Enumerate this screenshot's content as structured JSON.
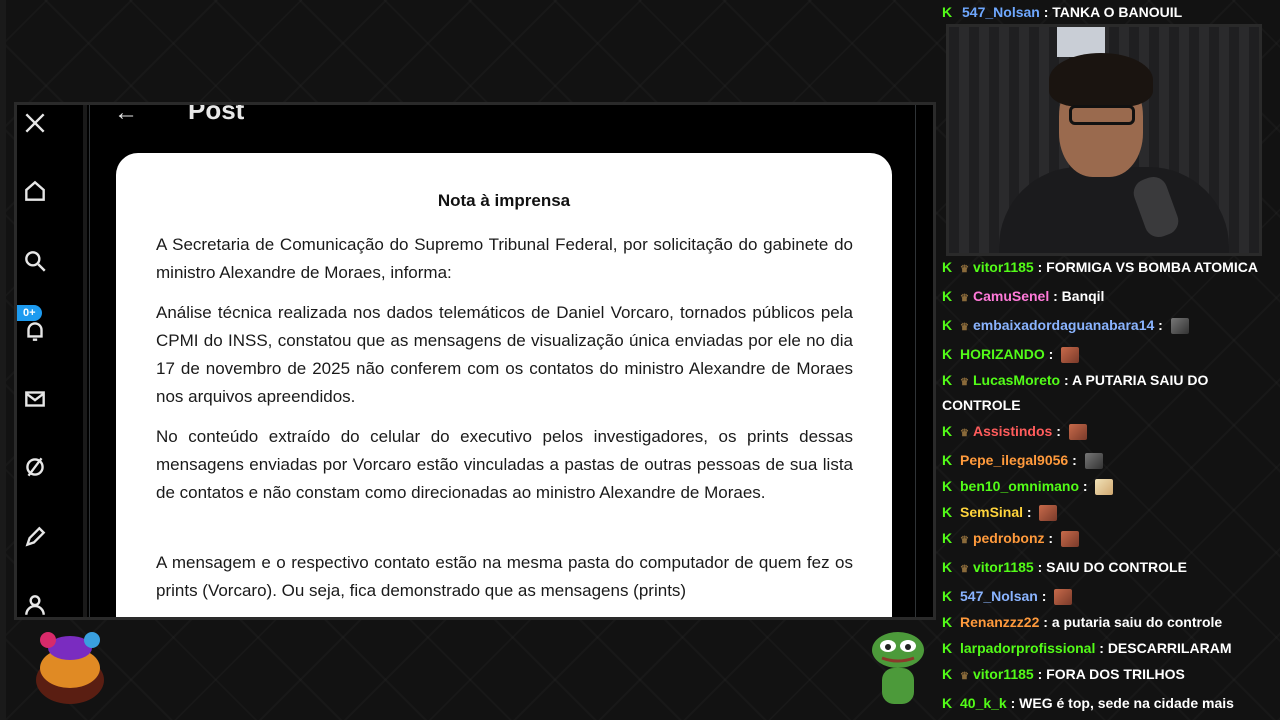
{
  "post_header": {
    "back_glyph": "←",
    "title": "Post"
  },
  "sidebar": {
    "icons": [
      "x-logo-icon",
      "home-icon",
      "search-icon",
      "notifications-icon",
      "messages-icon",
      "grok-icon",
      "compose-icon",
      "profile-icon"
    ],
    "badge": "0+"
  },
  "document": {
    "title": "Nota à imprensa",
    "paragraphs": [
      "A Secretaria de Comunicação do Supremo Tribunal Federal, por solicitação do gabinete do ministro Alexandre de Moraes, informa:",
      "Análise técnica realizada nos dados telemáticos de Daniel Vorcaro, tornados públicos pela CPMI do INSS, constatou  que as mensagens de visualização única enviadas por ele no dia 17 de novembro de 2025 não conferem com os contatos do ministro Alexandre de Moraes nos arquivos apreendidos.",
      "No conteúdo extraído do celular do executivo pelos investigadores, os prints dessas mensagens enviadas por Vorcaro estão vinculadas a pastas de outras pessoas de sua lista de contatos e não constam como direcionadas ao ministro Alexandre de Moraes.",
      "A mensagem e o respectivo contato estão na mesma pasta do computador de quem fez os prints (Vorcaro). Ou seja, fica demonstrado que as mensagens (prints)"
    ]
  },
  "chat": {
    "top_message": {
      "user": "547_Nolsan",
      "user_color": "#6fa8ff",
      "text": "TANKA O BANOUIL"
    },
    "messages": [
      {
        "badge": true,
        "user": "vitor1185",
        "color": "#53fc18",
        "text": "FORMIGA VS BOMBA ATOMICA",
        "emote": ""
      },
      {
        "badge": true,
        "user": "CamuSenel",
        "color": "#ff7ad9",
        "text": "Banqil",
        "emote": ""
      },
      {
        "badge": true,
        "user": "embaixadordaguanabara14",
        "color": "#8ab4ff",
        "text": "",
        "emote": "em-grey"
      },
      {
        "badge": false,
        "user": "HORIZANDO",
        "color": "#53fc18",
        "text": "",
        "emote": "em-red"
      },
      {
        "badge": true,
        "user": "LucasMoreto",
        "color": "#53fc18",
        "text": "A PUTARIA SAIU DO CONTROLE",
        "emote": ""
      },
      {
        "badge": true,
        "user": "Assistindos",
        "color": "#ff5c5c",
        "text": "",
        "emote": "em-red"
      },
      {
        "badge": false,
        "user": "Pepe_ilegal9056",
        "color": "#ff9a3c",
        "text": "",
        "emote": "em-grey"
      },
      {
        "badge": false,
        "user": "ben10_omnimano",
        "color": "#53fc18",
        "text": "",
        "emote": "em-pale"
      },
      {
        "badge": false,
        "user": "SemSinal",
        "color": "#ffd43c",
        "text": "",
        "emote": "em-red"
      },
      {
        "badge": true,
        "user": "pedrobonz",
        "color": "#ff9a3c",
        "text": "",
        "emote": "em-red"
      },
      {
        "badge": true,
        "user": "vitor1185",
        "color": "#53fc18",
        "text": "SAIU DO CONTROLE",
        "emote": ""
      },
      {
        "badge": false,
        "user": "547_Nolsan",
        "color": "#8ab4ff",
        "text": "",
        "emote": "em-red"
      },
      {
        "badge": false,
        "user": "Renanzzz22",
        "color": "#ff9a3c",
        "text": "a putaria saiu do controle",
        "emote": ""
      },
      {
        "badge": false,
        "user": "larpadorprofissional",
        "color": "#53fc18",
        "text": "DESCARRILARAM",
        "emote": ""
      },
      {
        "badge": true,
        "user": "vitor1185",
        "color": "#53fc18",
        "text": "FORA DOS TRILHOS",
        "emote": ""
      },
      {
        "badge": false,
        "user": "40_k_k",
        "color": "#53fc18",
        "text": "WEG é top, sede na cidade mais segura do Brasil",
        "emote": ""
      }
    ]
  }
}
